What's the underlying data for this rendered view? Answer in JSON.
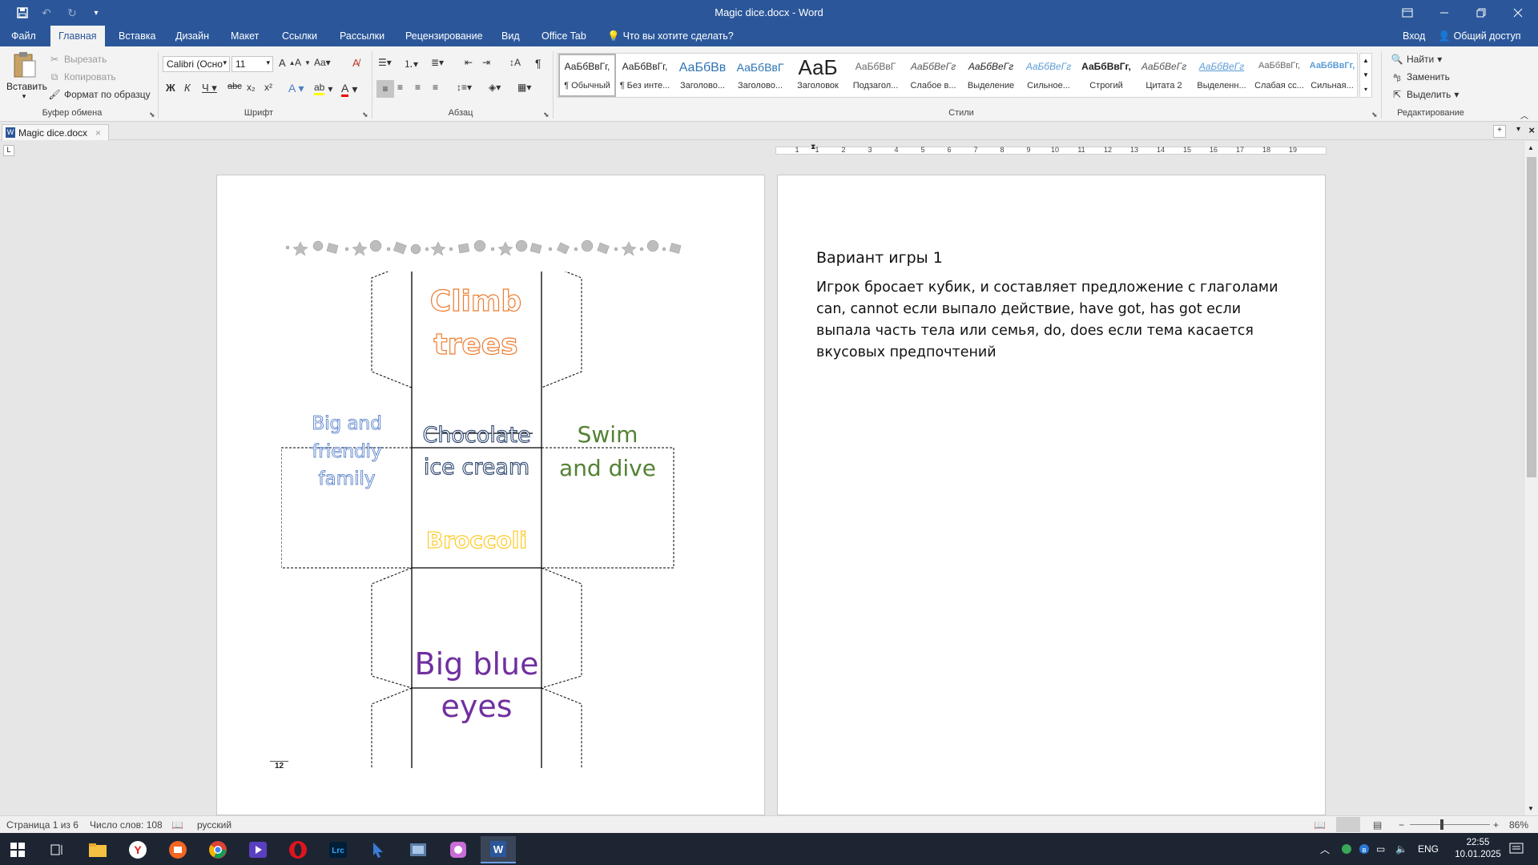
{
  "window": {
    "title": "Magic dice.docx - Word",
    "signin": "Вход",
    "share": "Общий доступ"
  },
  "tabs": [
    "Файл",
    "Главная",
    "Вставка",
    "Дизайн",
    "Макет",
    "Ссылки",
    "Рассылки",
    "Рецензирование",
    "Вид",
    "Office Tab"
  ],
  "tellme": "Что вы хотите сделать?",
  "clipboard": {
    "paste": "Вставить",
    "cut": "Вырезать",
    "copy": "Копировать",
    "format_painter": "Формат по образцу",
    "label": "Буфер обмена"
  },
  "font": {
    "name": "Calibri (Осно",
    "size": "11",
    "label": "Шрифт"
  },
  "paragraph": {
    "label": "Абзац"
  },
  "styles": {
    "label": "Стили",
    "items": [
      {
        "preview": "АаБбВвГг,",
        "label": "¶ Обычный"
      },
      {
        "preview": "АаБбВвГг,",
        "label": "¶ Без инте..."
      },
      {
        "preview": "АаБбВв",
        "label": "Заголово..."
      },
      {
        "preview": "АаБбВвГ",
        "label": "Заголово..."
      },
      {
        "preview": "АаБ",
        "label": "Заголовок"
      },
      {
        "preview": "АаБбВвГ",
        "label": "Подзагол..."
      },
      {
        "preview": "АаБбВеГг",
        "label": "Слабое в..."
      },
      {
        "preview": "АаБбВеГг",
        "label": "Выделение"
      },
      {
        "preview": "АаБбВеГг",
        "label": "Сильное..."
      },
      {
        "preview": "АаБбВвГг,",
        "label": "Строгий"
      },
      {
        "preview": "АаБбВеГг",
        "label": "Цитата 2"
      },
      {
        "preview": "АаБбВеГг",
        "label": "Выделенн..."
      },
      {
        "preview": "АаБбВвГг,",
        "label": "Слабая сс..."
      },
      {
        "preview": "АаБбВвГг,",
        "label": "Сильная..."
      }
    ]
  },
  "editing": {
    "label": "Редактирование",
    "find": "Найти",
    "replace": "Заменить",
    "select": "Выделить"
  },
  "doc_tab": "Magic dice.docx",
  "ruler_numbers": [
    "1",
    "1",
    "2",
    "3",
    "4",
    "5",
    "6",
    "7",
    "8",
    "9",
    "10",
    "11",
    "12",
    "13",
    "14",
    "15",
    "16",
    "17",
    "18",
    "19"
  ],
  "dice": {
    "top": "Climb trees",
    "left": "Big and friendly family",
    "center": "Chocolate ice cream",
    "right": "Swim and dive",
    "middle_bottom": "Broccoli",
    "bottom": "Big blue eyes",
    "page_number": "12"
  },
  "right_page": {
    "heading": "Вариант игры 1",
    "body": "Игрок бросает кубик, и составляет предложение с глаголами can, cannot если выпало действие, have got, has got если выпала часть тела или семья, do, does если тема касается вкусовых предпочтений"
  },
  "status": {
    "page": "Страница 1 из 6",
    "words": "Число слов: 108",
    "lang": "русский",
    "zoom": "86%"
  },
  "tray": {
    "lang": "ENG",
    "time": "22:55",
    "date": "10.01.2025"
  },
  "colors": {
    "word_blue": "#2b579a",
    "climb": "#f2a06a",
    "family": "#8ea9db",
    "chocolate": "#44546a",
    "swim": "#548235",
    "broccoli": "#ffd966",
    "eyes": "#7030a0"
  }
}
